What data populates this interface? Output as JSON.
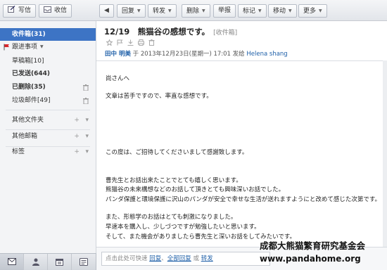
{
  "toolbar": {
    "compose": "写信",
    "inbox": "收信",
    "reply": "回复",
    "forward": "转发",
    "delete": "删除",
    "report": "举报",
    "mark": "标记",
    "move": "移动",
    "more": "更多"
  },
  "sidebar": {
    "inbox": "收件箱(31)",
    "followup": "跟进事项",
    "drafts": "草稿箱[10]",
    "sent": "已发送(644)",
    "deleted": "已删除(35)",
    "spam": "垃圾邮件[49]",
    "other_folders": "其他文件夹",
    "other_mailboxes": "其他邮箱",
    "tags": "标签"
  },
  "email": {
    "subject": "12/19　熊猫谷の感想です。",
    "folder": "[收件箱]",
    "sender": "田中 明美",
    "meta_prefix": "于 2013年12月23日(星期一) 17:01 发给",
    "recipient": "Helena shang",
    "body": [
      "尚さんへ",
      "文章は苦手ですので、率直な感想です。",
      "この度は、ご招待してくださいまして感謝致します。",
      "曹先生とお話出来たことでとても嬉しく思います。",
      "熊猫谷の未来構想などのお話して頂きとても興味深いお話でした。",
      "パンダ保護と環境保護に沢山のパンダが安全で幸せな生活が送れますようにと改めて感じた次第です。",
      "また、形態学のお話はとても刺激になりました。",
      "早速本を購入し、少しづつですが勉強したいと思います。",
      "そして、また機会がありましたら曹先生と深いお話をしてみたいです。"
    ]
  },
  "reply_bar": {
    "prefix": "点击此处可快速",
    "reply": "回复",
    "sep1": "、",
    "reply_all": "全部回复",
    "sep2": "或",
    "forward": "转发"
  },
  "watermark": {
    "cn": "成都大熊猫繁育研究基金会",
    "en": "www.pandahome.org"
  },
  "colors": {
    "accent": "#3d74c5",
    "link": "#1e5fa8"
  }
}
